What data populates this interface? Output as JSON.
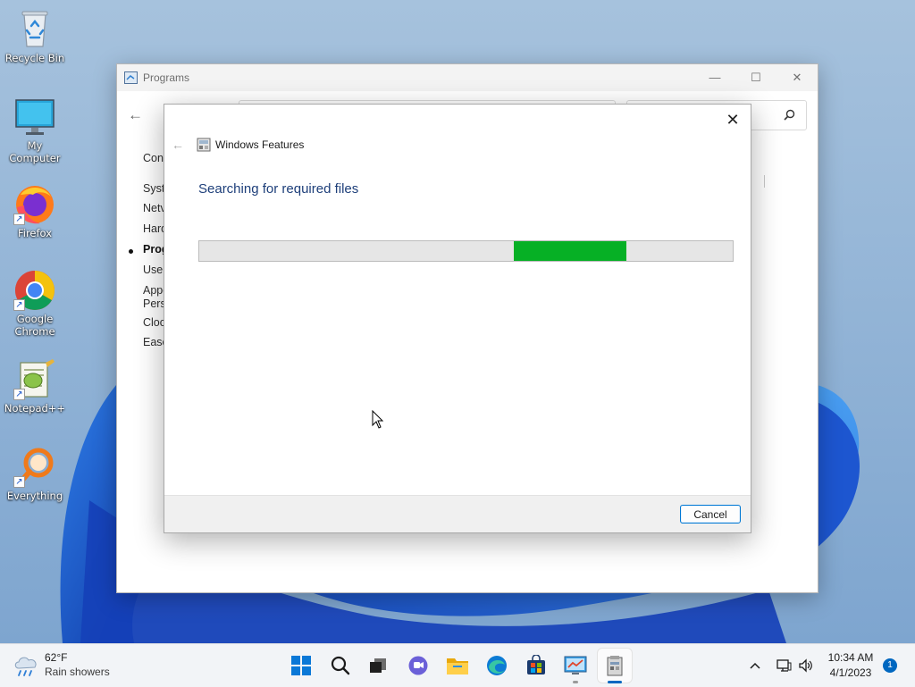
{
  "desktop": {
    "icons": [
      {
        "label": "Recycle Bin",
        "icon": "recycle-bin-icon"
      },
      {
        "label": "My Computer",
        "icon": "monitor-icon"
      },
      {
        "label": "Firefox",
        "icon": "firefox-icon"
      },
      {
        "label": "Google Chrome",
        "icon": "chrome-icon"
      },
      {
        "label": "Notepad++",
        "icon": "notepad-plus-plus-icon"
      },
      {
        "label": "Everything",
        "icon": "everything-search-icon"
      }
    ]
  },
  "programs_window": {
    "title": "Programs",
    "minimize_glyph": "—",
    "maximize_glyph": "☐",
    "close_glyph": "✕",
    "back_glyph": "←",
    "sidebar_items": [
      "Cont",
      "Syste",
      "Netv",
      "Hard",
      "Prog",
      "User",
      "Appe",
      "Pers",
      "Cloc",
      "Ease"
    ],
    "active_sidebar_item": "Prog",
    "right_fragment": "s"
  },
  "features_dialog": {
    "back_glyph": "←",
    "title": "Windows Features",
    "heading": "Searching for required files",
    "close_glyph": "✕",
    "cancel_label": "Cancel",
    "progress": {
      "mode": "indeterminate marquee",
      "chunk_start_fraction": 0.59,
      "chunk_end_fraction": 0.8,
      "color": "#06b025"
    }
  },
  "taskbar": {
    "weather_temp": "62°F",
    "weather_desc": "Rain showers",
    "apps": [
      "start-icon",
      "search-icon",
      "task-view-icon",
      "chat-icon",
      "file-explorer-icon",
      "edge-icon",
      "store-icon",
      "control-panel-icon",
      "windows-features-icon"
    ],
    "tray_chevron": "^",
    "time": "10:34 AM",
    "date": "4/1/2023",
    "notification_count": "1"
  },
  "colors": {
    "accent": "#0067c0",
    "progress_green": "#06b025",
    "heading_blue": "#1e3f7a",
    "wallpaper_blue": "#1a4fbf"
  }
}
